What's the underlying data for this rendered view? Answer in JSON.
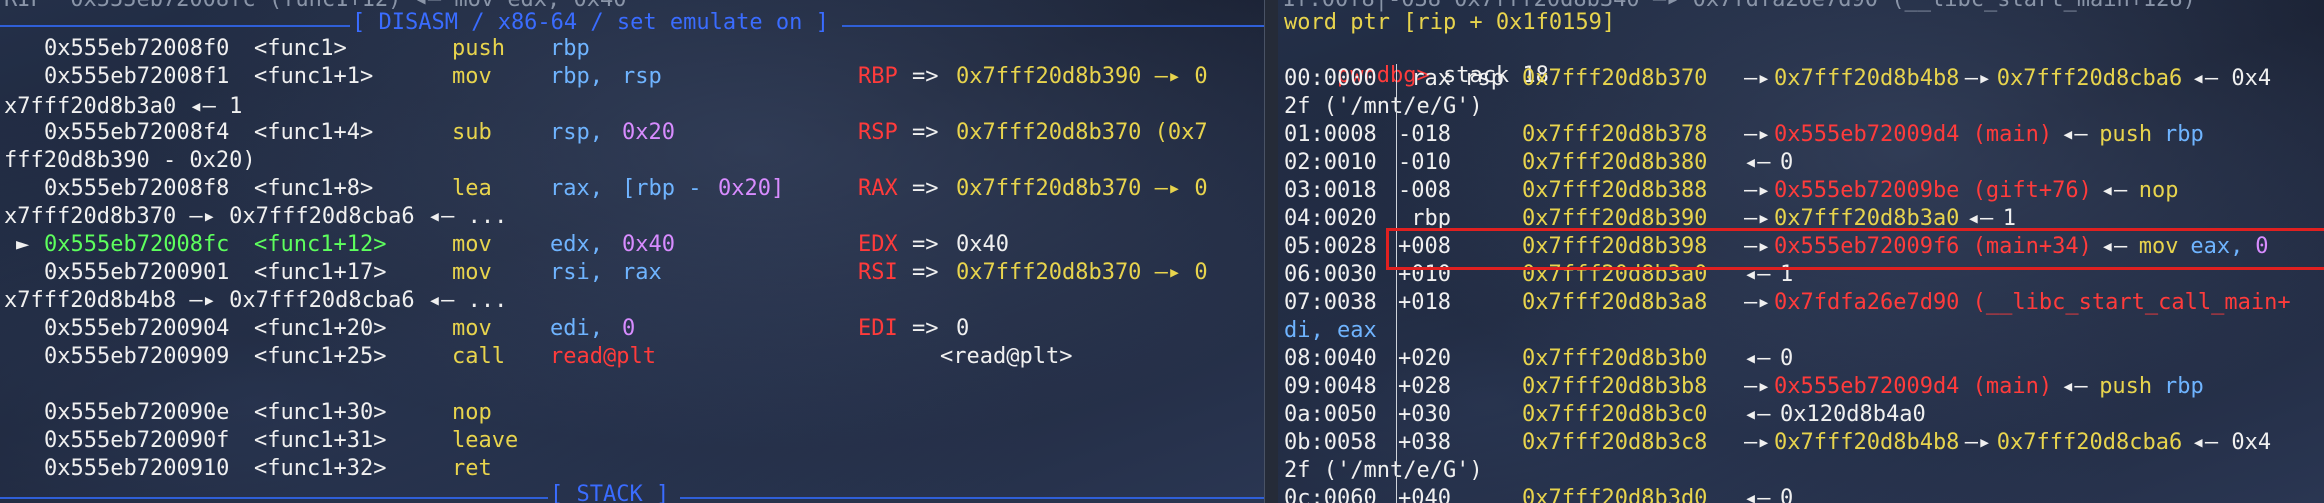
{
  "left": {
    "header_title": "[ DISASM / x86-64 / set emulate on ]",
    "footer_title": "[ STACK ]",
    "top_cut": "RIP  0x555eb72008fc (func1+12) ◂— mov edx, 0x40",
    "rows": [
      {
        "addr": "0x555eb72008f0",
        "sym": "<func1>",
        "mn": "push",
        "op1": "rbp",
        "op2": "",
        "op2b": "",
        "reg": "",
        "val": ""
      },
      {
        "addr": "0x555eb72008f1",
        "sym": "<func1+1>",
        "mn": "mov",
        "op1": "rbp,",
        "op2": "rsp",
        "op2b": "",
        "reg": "RBP",
        "val": "0x7fff20d8b390 —▸ 0"
      },
      {
        "addr": "0x555eb72008f4",
        "sym": "<func1+4>",
        "mn": "sub",
        "op1": "rsp,",
        "op2": "0x20",
        "op2b": "",
        "reg": "RSP",
        "val": "0x7fff20d8b370 (0x7"
      },
      {
        "addr": "0x555eb72008f8",
        "sym": "<func1+8>",
        "mn": "lea",
        "op1": "rax,",
        "op2": "[rbp - ",
        "op2b": "0x20]",
        "reg": "RAX",
        "val": "0x7fff20d8b370 —▸ 0"
      },
      {
        "addr": "0x555eb72008fc",
        "sym": "<func1+12>",
        "mn": "mov",
        "op1": "edx,",
        "op2": "0x40",
        "op2b": "",
        "reg": "EDX",
        "val": "0x40"
      },
      {
        "addr": "0x555eb7200901",
        "sym": "<func1+17>",
        "mn": "mov",
        "op1": "rsi,",
        "op2": "rax",
        "op2b": "",
        "reg": "RSI",
        "val": "0x7fff20d8b370 —▸ 0"
      },
      {
        "addr": "0x555eb7200904",
        "sym": "<func1+20>",
        "mn": "mov",
        "op1": "edi,",
        "op2": "0",
        "op2b": "",
        "reg": "EDI",
        "val": "0"
      },
      {
        "addr": "0x555eb7200909",
        "sym": "<func1+25>",
        "mn": "call",
        "op1": "read@plt",
        "op2": "",
        "op2b": "",
        "reg": "",
        "val": ""
      },
      {
        "addr": "0x555eb720090e",
        "sym": "<func1+30>",
        "mn": "nop",
        "op1": "",
        "op2": "",
        "op2b": "",
        "reg": "",
        "val": ""
      },
      {
        "addr": "0x555eb720090f",
        "sym": "<func1+31>",
        "mn": "leave",
        "op1": "",
        "op2": "",
        "op2b": "",
        "reg": "",
        "val": ""
      },
      {
        "addr": "0x555eb7200910",
        "sym": "<func1+32>",
        "mn": "ret",
        "op1": "",
        "op2": "",
        "op2b": "",
        "reg": "",
        "val": ""
      }
    ],
    "wraps": {
      "w1": "x7fff20d8b3a0 ◂— 1",
      "w2": "fff20d8b390 - 0x20)",
      "w3a": "x7fff20d8b370 —▸ 0x7fff20d8cba6 ◂— ...",
      "w5a": "x7fff20d8b4b8 —▸ 0x7fff20d8cba6 ◂— ..."
    },
    "arrow": "►",
    "call_target": "<read@plt>"
  },
  "right": {
    "top_cut": "1f:00f8│-038 0x7fff20d8b340 —▸ 0x7fdfa26e7d90 (__libc_start_main+128)",
    "line0": "word ptr [rip + 0x1f0159]",
    "prompt": "pwndbg>",
    "command": "stack 18",
    "rows": [
      {
        "idx": "00:0000",
        "off": " rax rsp",
        "a": "0x7fff20d8b370",
        "p1": "0x7fff20d8b4b8",
        "p2": "0x7fff20d8cba6",
        "tail": "◂— 0x4"
      },
      {
        "idx": "01:0008",
        "off": "-018",
        "a": "0x7fff20d8b378",
        "p1": "0x555eb72009d4 (main)",
        "ins": "push",
        "reg": "rbp"
      },
      {
        "idx": "02:0010",
        "off": "-010",
        "a": "0x7fff20d8b380",
        "val": "0"
      },
      {
        "idx": "03:0018",
        "off": "-008",
        "a": "0x7fff20d8b388",
        "p1": "0x555eb72009be (gift+76)",
        "ins": "nop"
      },
      {
        "idx": "04:0020",
        "off": " rbp",
        "a": "0x7fff20d8b390",
        "p1": "0x7fff20d8b3a0",
        "val": "1"
      },
      {
        "idx": "05:0028",
        "off": "+008",
        "a": "0x7fff20d8b398",
        "p1": "0x555eb72009f6 (main+34)",
        "ins": "mov",
        "reg": "eax,",
        "op": "0"
      },
      {
        "idx": "06:0030",
        "off": "+010",
        "a": "0x7fff20d8b3a0",
        "val": "1"
      },
      {
        "idx": "07:0038",
        "off": "+018",
        "a": "0x7fff20d8b3a8",
        "p1": "0x7fdfa26e7d90 (__libc_start_call_main+"
      },
      {
        "idx": "08:0040",
        "off": "+020",
        "a": "0x7fff20d8b3b0",
        "val": "0"
      },
      {
        "idx": "09:0048",
        "off": "+028",
        "a": "0x7fff20d8b3b8",
        "p1": "0x555eb72009d4 (main)",
        "ins": "push",
        "reg": "rbp"
      },
      {
        "idx": "0a:0050",
        "off": "+030",
        "a": "0x7fff20d8b3c0",
        "val": "0x120d8b4a0"
      },
      {
        "idx": "0b:0058",
        "off": "+038",
        "a": "0x7fff20d8b3c8",
        "p1": "0x7fff20d8b4b8",
        "p2": "0x7fff20d8cba6",
        "tail": "◂— 0x4"
      },
      {
        "idx": "0c:0060",
        "off": "+040",
        "a": "0x7fff20d8b3d0",
        "val": "0"
      }
    ],
    "wraps": {
      "r0": "2f ('/mnt/e/G')",
      "r7": "di, eax",
      "r11": "2f ('/mnt/e/G')"
    },
    "arrow_ptr": "—▸",
    "arrow_val": "◂—"
  },
  "colors": {
    "yellow": "#e8d44d",
    "blue": "#6fb4ff",
    "red": "#ff3b3b",
    "purple": "#d88cff",
    "green": "#5dff5d",
    "header": "#3a6cff",
    "highlight": "#e02020"
  }
}
